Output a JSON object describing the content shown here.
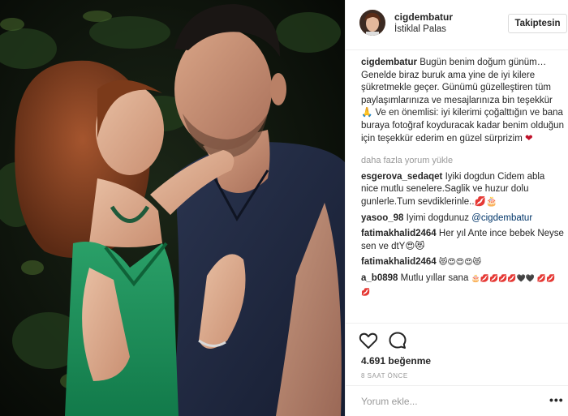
{
  "header": {
    "username": "cigdembatur",
    "location": "İstiklal Palas",
    "follow_label": "Takiptesin"
  },
  "caption": {
    "user": "cigdembatur",
    "text": "Bugün benim doğum günüm… Genelde biraz buruk ama yine de iyi kilere şükretmekle geçer. Günümü güzelleştiren tüm paylaşımlarınıza ve mesajlarınıza bin teşekkür 🙏 Ve en önemlisi: iyi kilerimi çoğalttığın ve bana buraya fotoğraf koyduracak kadar benim olduğun için teşekkür ederim en güzel sürprizim",
    "heart": "❤"
  },
  "load_more": "daha fazla yorum yükle",
  "comments": [
    {
      "user": "esgerova_sedaqet",
      "text": "Iyiki dogdun Cidem abla nice mutlu senelere.Saglik ve huzur dolu gunlerle.Tum sevdiklerinle..💋🎂"
    },
    {
      "user": "yasoo_98",
      "text": "Iyimi dogdunuz",
      "mention": "@cigdembatur"
    },
    {
      "user": "fatimakhalid2464",
      "text": "Her yıl Ante ince bebek Neyse sen ve dtY😍😻"
    },
    {
      "user": "fatimakhalid2464",
      "text": "😻😍😍😍😻"
    },
    {
      "user": "a_b0898",
      "text": "Mutlu yıllar sana",
      "extra": "🎂💋💋💋💋🖤🖤 💋💋💋"
    }
  ],
  "likes": "4.691 beğenme",
  "timestamp": "8 SAAT ÖNCE",
  "comment_placeholder": "Yorum ekle...",
  "more_label": "•••",
  "icons": [
    "heart-outline-icon",
    "comment-icon",
    "more-options-icon"
  ],
  "colors": {
    "border": "#efefef",
    "text": "#262626",
    "muted": "#999999",
    "heart": "#c0122a"
  }
}
